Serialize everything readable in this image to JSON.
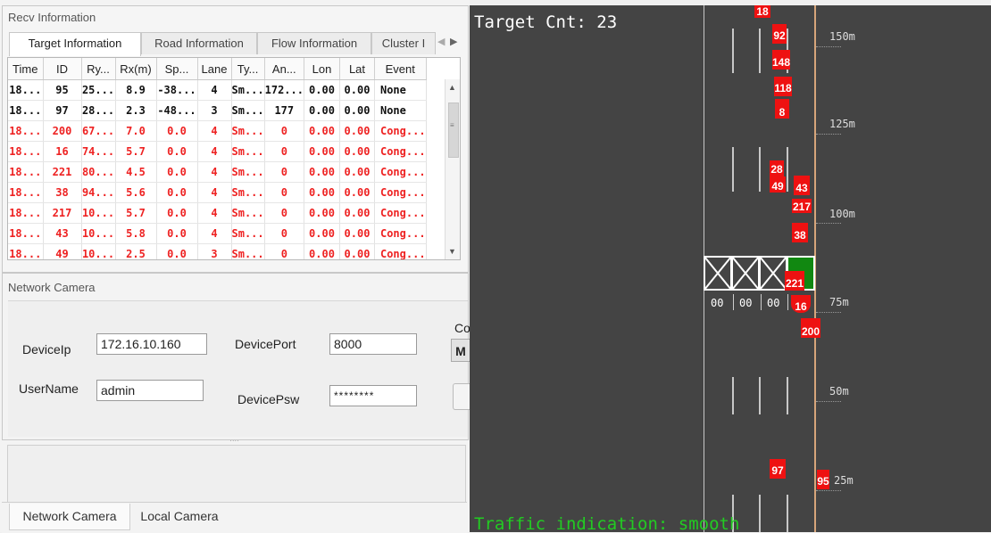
{
  "recv_panel": {
    "title": "Recv Information",
    "tabs": [
      "Target Information",
      "Road Information",
      "Flow Information",
      "Cluster I"
    ],
    "columns": [
      "Time",
      "ID",
      "Ry...",
      "Rx(m)",
      "Sp...",
      "Lane",
      "Ty...",
      "An...",
      "Lon",
      "Lat",
      "Event"
    ],
    "rows": [
      {
        "time": "18...",
        "id": "95",
        "ry": "25...",
        "rx": "8.9",
        "sp": "-38...",
        "lane": "4",
        "ty": "Sm...",
        "an": "172...",
        "lon": "0.00",
        "lat": "0.00",
        "event": "None",
        "red": false
      },
      {
        "time": "18...",
        "id": "97",
        "ry": "28...",
        "rx": "2.3",
        "sp": "-48...",
        "lane": "3",
        "ty": "Sm...",
        "an": "177",
        "lon": "0.00",
        "lat": "0.00",
        "event": "None",
        "red": false
      },
      {
        "time": "18...",
        "id": "200",
        "ry": "67...",
        "rx": "7.0",
        "sp": "0.0",
        "lane": "4",
        "ty": "Sm...",
        "an": "0",
        "lon": "0.00",
        "lat": "0.00",
        "event": "Cong...",
        "red": true
      },
      {
        "time": "18...",
        "id": "16",
        "ry": "74...",
        "rx": "5.7",
        "sp": "0.0",
        "lane": "4",
        "ty": "Sm...",
        "an": "0",
        "lon": "0.00",
        "lat": "0.00",
        "event": "Cong...",
        "red": true
      },
      {
        "time": "18...",
        "id": "221",
        "ry": "80...",
        "rx": "4.5",
        "sp": "0.0",
        "lane": "4",
        "ty": "Sm...",
        "an": "0",
        "lon": "0.00",
        "lat": "0.00",
        "event": "Cong...",
        "red": true
      },
      {
        "time": "18...",
        "id": "38",
        "ry": "94...",
        "rx": "5.6",
        "sp": "0.0",
        "lane": "4",
        "ty": "Sm...",
        "an": "0",
        "lon": "0.00",
        "lat": "0.00",
        "event": "Cong...",
        "red": true
      },
      {
        "time": "18...",
        "id": "217",
        "ry": "10...",
        "rx": "5.7",
        "sp": "0.0",
        "lane": "4",
        "ty": "Sm...",
        "an": "0",
        "lon": "0.00",
        "lat": "0.00",
        "event": "Cong...",
        "red": true
      },
      {
        "time": "18...",
        "id": "43",
        "ry": "10...",
        "rx": "5.8",
        "sp": "0.0",
        "lane": "4",
        "ty": "Sm...",
        "an": "0",
        "lon": "0.00",
        "lat": "0.00",
        "event": "Cong...",
        "red": true
      },
      {
        "time": "18...",
        "id": "49",
        "ry": "10...",
        "rx": "2.5",
        "sp": "0.0",
        "lane": "3",
        "ty": "Sm...",
        "an": "0",
        "lon": "0.00",
        "lat": "0.00",
        "event": "Cong...",
        "red": true
      }
    ]
  },
  "camera_panel": {
    "title": "Network Camera",
    "device_ip_label": "DeviceIp",
    "device_ip": "172.16.10.160",
    "device_port_label": "DevicePort",
    "device_port": "8000",
    "username_label": "UserName",
    "username": "admin",
    "password_label": "DevicePsw",
    "password": "********",
    "cut_label": "Co",
    "cut_button": "M",
    "bottom_tabs": [
      "Network Camera",
      "Local Camera"
    ]
  },
  "radar_view": {
    "target_count": "Target Cnt: 23",
    "traffic_indication": "Traffic indication: smooth",
    "distance_labels": [
      "150m",
      "125m",
      "100m",
      "75m",
      "50m",
      "25m"
    ],
    "lane_counters": [
      "00",
      "00",
      "00"
    ],
    "target_ids": [
      "18",
      "92",
      "148",
      "118",
      "8",
      "28",
      "49",
      "43",
      "217",
      "38",
      "221",
      "16",
      "200",
      "97",
      "95"
    ],
    "colors": {
      "road": "#444444",
      "target": "#ee1111",
      "indication": "#22cc22",
      "zone": "#118811",
      "edge_line": "#d6a57a"
    }
  }
}
